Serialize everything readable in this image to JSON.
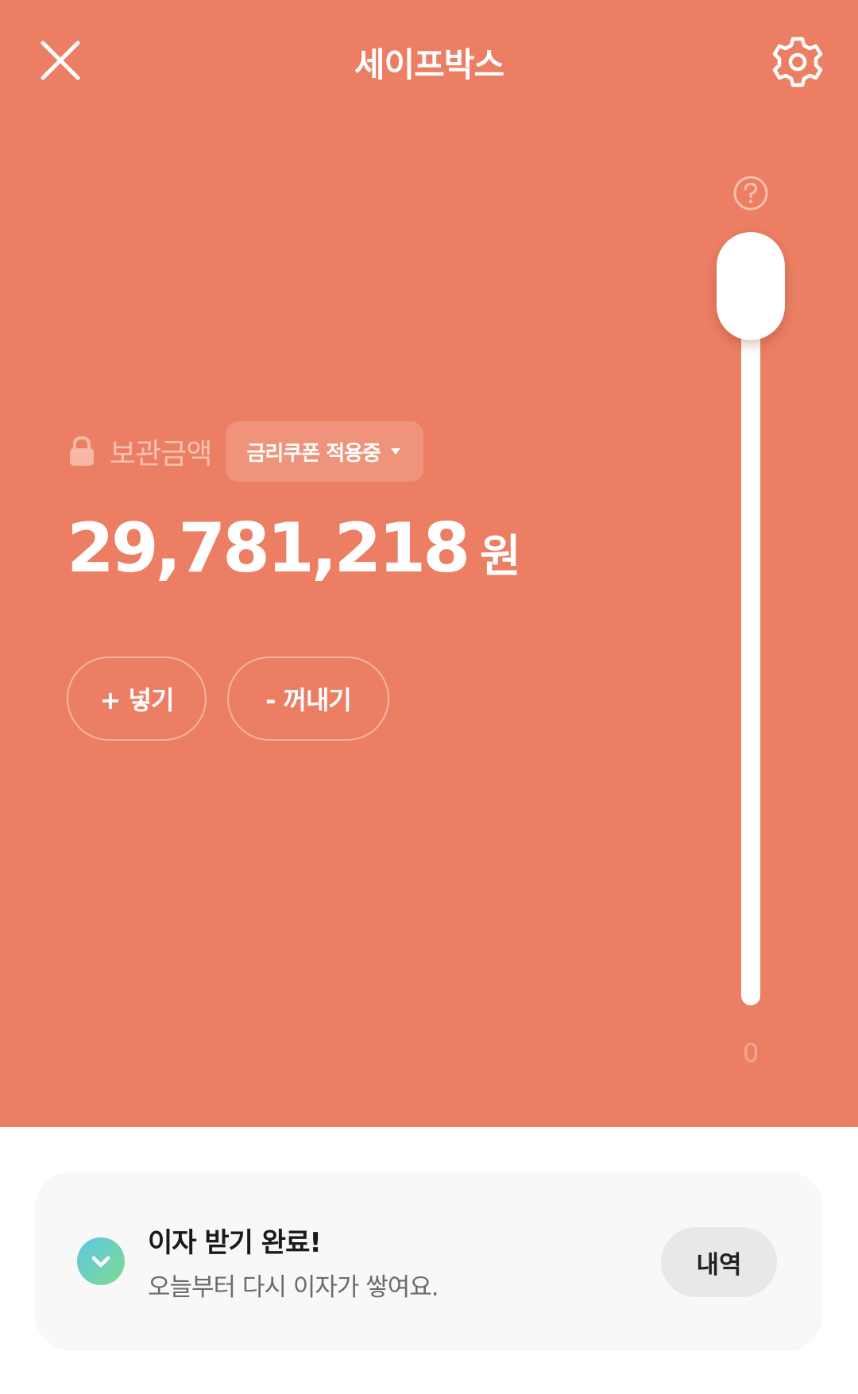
{
  "header": {
    "title": "세이프박스",
    "close_icon": "close-icon",
    "settings_icon": "gear-icon"
  },
  "safebox": {
    "help_icon": "question-circle-icon",
    "balance_label": "보관금액",
    "lock_icon": "lock-icon",
    "coupon_chip_label": "금리쿠폰 적용중",
    "balance_value": "29,781,218",
    "balance_unit": "원",
    "deposit_label": "+ 넣기",
    "withdraw_label": "- 꺼내기",
    "slider_min_label": "0",
    "slider_level": 1.0
  },
  "notice": {
    "icon": "check-down-icon",
    "title": "이자 받기 완료!",
    "subtitle": "오늘부터 다시 이자가 쌓여요.",
    "history_label": "내역"
  },
  "colors": {
    "background": "#EC7F63",
    "chip": "#EF937B",
    "card": "#F8F8F8"
  }
}
